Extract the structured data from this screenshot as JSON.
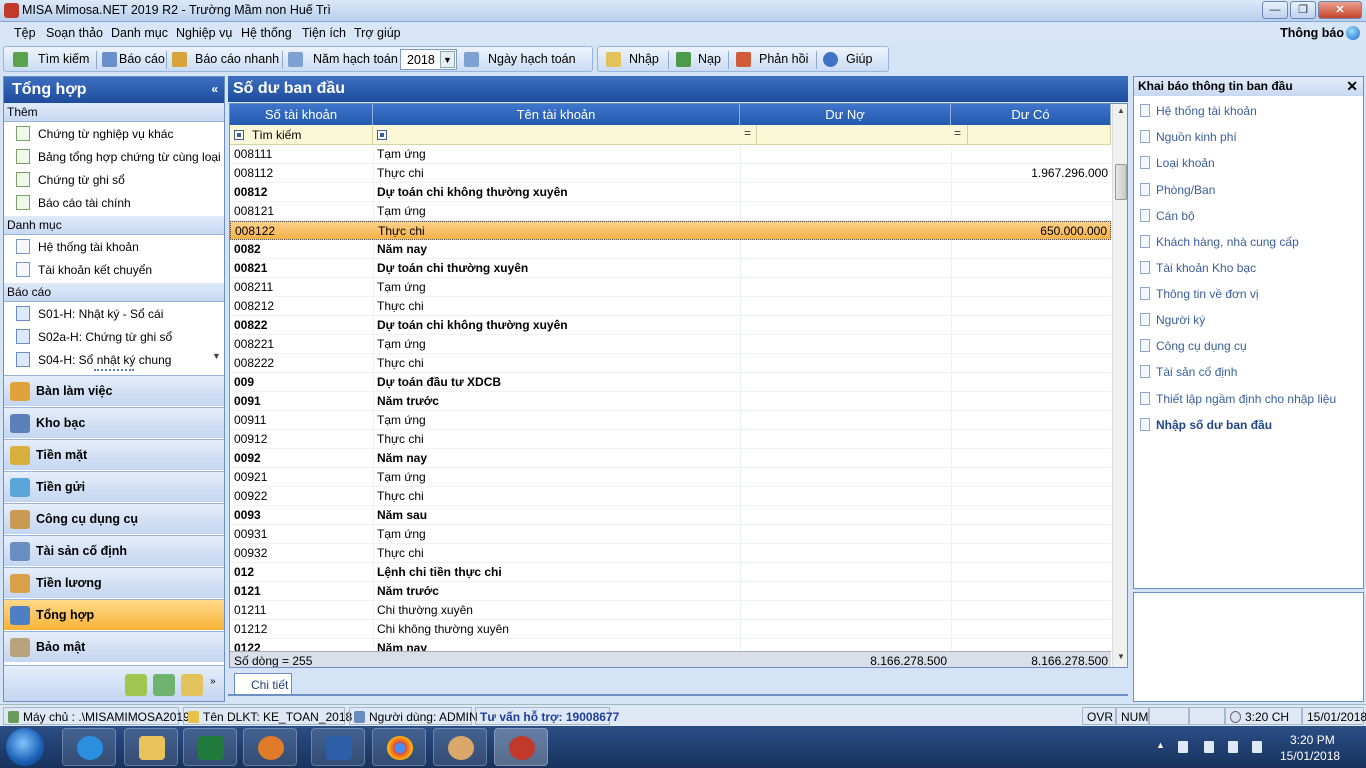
{
  "window": {
    "title": "MISA Mimosa.NET 2019 R2 - Trường Mầm non Huế Trì"
  },
  "menu": {
    "items": [
      "Tệp",
      "Soạn thảo",
      "Danh mục",
      "Nghiệp vụ",
      "Hệ thống",
      "Tiện ích",
      "Trợ giúp"
    ],
    "notify_label": "Thông báo"
  },
  "toolbar": {
    "search_label": "Tìm kiếm",
    "report_label": "Báo cáo",
    "quick_report_label": "Báo cáo nhanh",
    "fiscal_year_label": "Năm hạch toán",
    "fiscal_year_value": "2018",
    "posting_date_label": "Ngày hạch toán",
    "import_label": "Nhập",
    "load_label": "Nạp",
    "feedback_label": "Phản hồi",
    "help_label": "Giúp"
  },
  "left_panel": {
    "title": "Tổng hợp",
    "sections": {
      "add": {
        "title": "Thêm",
        "items": [
          "Chứng từ nghiệp vụ khác",
          "Bảng tổng hợp chứng từ cùng loại",
          "Chứng từ ghi sổ",
          "Báo cáo tài chính"
        ]
      },
      "catalog": {
        "title": "Danh mục",
        "items": [
          "Hệ thống tài khoản",
          "Tài khoản kết chuyển"
        ]
      },
      "reports": {
        "title": "Báo cáo",
        "items": [
          "S01-H: Nhật ký - Sổ cái",
          "S02a-H: Chứng từ ghi sổ",
          "S04-H: Sổ nhật ký chung"
        ]
      }
    },
    "nav": [
      "Bàn làm việc",
      "Kho bạc",
      "Tiền mặt",
      "Tiền gửi",
      "Công cụ dụng cụ",
      "Tài sản cố định",
      "Tiền lương",
      "Tổng hợp",
      "Bảo mật"
    ],
    "active_nav": "Tổng hợp"
  },
  "main": {
    "title": "Số dư ban đầu",
    "columns": [
      "Số tài khoản",
      "Tên tài khoản",
      "Dư Nợ",
      "Dư Có"
    ],
    "filter_placeholder": "Tìm kiếm",
    "filter_eq": "=",
    "rows": [
      {
        "acct": "008111",
        "name": "Tạm ứng",
        "debit": "",
        "credit": "",
        "bold": false
      },
      {
        "acct": "008112",
        "name": "Thực chi",
        "debit": "",
        "credit": "1.967.296.000",
        "bold": false
      },
      {
        "acct": "00812",
        "name": "Dự toán chi không thường xuyên",
        "debit": "",
        "credit": "",
        "bold": true
      },
      {
        "acct": "008121",
        "name": "Tạm ứng",
        "debit": "",
        "credit": "",
        "bold": false
      },
      {
        "acct": "008122",
        "name": "Thực chi",
        "debit": "",
        "credit": "650.000.000",
        "bold": false,
        "selected": true
      },
      {
        "acct": "0082",
        "name": "Năm nay",
        "debit": "",
        "credit": "",
        "bold": true
      },
      {
        "acct": "00821",
        "name": "Dự toán chi thường xuyên",
        "debit": "",
        "credit": "",
        "bold": true
      },
      {
        "acct": "008211",
        "name": "Tạm ứng",
        "debit": "",
        "credit": "",
        "bold": false
      },
      {
        "acct": "008212",
        "name": "Thực chi",
        "debit": "",
        "credit": "",
        "bold": false
      },
      {
        "acct": "00822",
        "name": "Dự toán chi không thường xuyên",
        "debit": "",
        "credit": "",
        "bold": true
      },
      {
        "acct": "008221",
        "name": "Tạm ứng",
        "debit": "",
        "credit": "",
        "bold": false
      },
      {
        "acct": "008222",
        "name": "Thực chi",
        "debit": "",
        "credit": "",
        "bold": false
      },
      {
        "acct": "009",
        "name": "Dự toán đầu tư XDCB",
        "debit": "",
        "credit": "",
        "bold": true
      },
      {
        "acct": "0091",
        "name": "Năm trước",
        "debit": "",
        "credit": "",
        "bold": true
      },
      {
        "acct": "00911",
        "name": "Tạm ứng",
        "debit": "",
        "credit": "",
        "bold": false
      },
      {
        "acct": "00912",
        "name": "Thực chi",
        "debit": "",
        "credit": "",
        "bold": false
      },
      {
        "acct": "0092",
        "name": "Năm nay",
        "debit": "",
        "credit": "",
        "bold": true
      },
      {
        "acct": "00921",
        "name": "Tạm ứng",
        "debit": "",
        "credit": "",
        "bold": false
      },
      {
        "acct": "00922",
        "name": "Thực chi",
        "debit": "",
        "credit": "",
        "bold": false
      },
      {
        "acct": "0093",
        "name": "Năm sau",
        "debit": "",
        "credit": "",
        "bold": true
      },
      {
        "acct": "00931",
        "name": "Tạm ứng",
        "debit": "",
        "credit": "",
        "bold": false
      },
      {
        "acct": "00932",
        "name": "Thực chi",
        "debit": "",
        "credit": "",
        "bold": false
      },
      {
        "acct": "012",
        "name": "Lệnh chi tiền thực chi",
        "debit": "",
        "credit": "",
        "bold": true
      },
      {
        "acct": "0121",
        "name": "Năm trước",
        "debit": "",
        "credit": "",
        "bold": true
      },
      {
        "acct": "01211",
        "name": "Chi thường xuyên",
        "debit": "",
        "credit": "",
        "bold": false
      },
      {
        "acct": "01212",
        "name": "Chi không thường xuyên",
        "debit": "",
        "credit": "",
        "bold": false
      },
      {
        "acct": "0122",
        "name": "Năm nay",
        "debit": "",
        "credit": "",
        "bold": true
      }
    ],
    "footer": {
      "row_count": "Số dòng = 255",
      "total_debit": "8.166.278.500",
      "total_credit": "8.166.278.500"
    },
    "tab_label": "Chi tiết"
  },
  "right_panel": {
    "title": "Khai báo thông tin ban đầu",
    "items": [
      "Hệ thống tài khoản",
      "Nguồn kinh phí",
      "Loại khoản",
      "Phòng/Ban",
      "Cán bộ",
      "Khách hàng, nhà cung cấp",
      "Tài khoản Kho bạc",
      "Thông tin về đơn vị",
      "Người ký",
      "Công cụ dụng cụ",
      "Tài sản cố định",
      "Thiết lập ngầm định cho nhập liệu",
      "Nhập số dư ban đầu"
    ]
  },
  "statusbar": {
    "server": "Máy chủ : .\\MISAMIMOSA2019",
    "database": "Tên DLKT: KE_TOAN_2018",
    "user": "Người dùng: ADMIN",
    "support": "Tư vấn hỗ trợ: 19008677",
    "ovr": "OVR",
    "num": "NUM",
    "time": "3:20 CH",
    "date": "15/01/2018"
  },
  "taskbar": {
    "clock_time": "3:20 PM",
    "clock_date": "15/01/2018"
  }
}
